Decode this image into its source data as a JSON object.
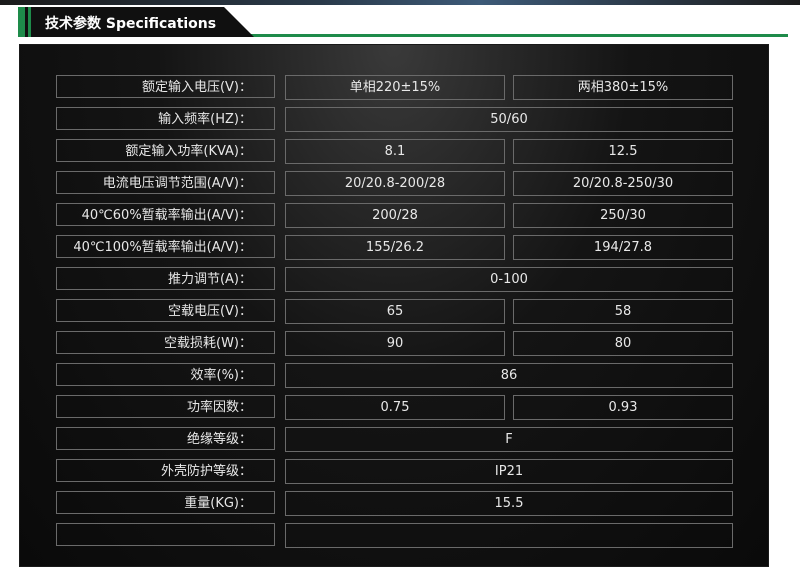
{
  "header": {
    "title": "技术参数 Specifications"
  },
  "rows": [
    {
      "label": "额定输入电压(V)：",
      "v1": "单相220±15%",
      "v2": "两相380±15%"
    },
    {
      "label": "输入频率(HZ)：",
      "full": "50/60"
    },
    {
      "label": "额定输入功率(KVA)：",
      "v1": "8.1",
      "v2": "12.5"
    },
    {
      "label": "电流电压调节范围(A/V)：",
      "v1": "20/20.8-200/28",
      "v2": "20/20.8-250/30"
    },
    {
      "label": "40℃60%暂载率输出(A/V)：",
      "v1": "200/28",
      "v2": "250/30"
    },
    {
      "label": "40℃100%暂载率输出(A/V)：",
      "v1": "155/26.2",
      "v2": "194/27.8"
    },
    {
      "label": "推力调节(A)：",
      "full": "0-100"
    },
    {
      "label": "空载电压(V)：",
      "v1": "65",
      "v2": "58"
    },
    {
      "label": "空载损耗(W)：",
      "v1": "90",
      "v2": "80"
    },
    {
      "label": "效率(%)：",
      "full": "86"
    },
    {
      "label": "功率因数：",
      "v1": "0.75",
      "v2": "0.93"
    },
    {
      "label": "绝缘等级：",
      "full": "F"
    },
    {
      "label": "外壳防护等级：",
      "full": "IP21"
    },
    {
      "label": "重量(KG)：",
      "full": "15.5"
    },
    {
      "label": "",
      "full": ""
    }
  ]
}
